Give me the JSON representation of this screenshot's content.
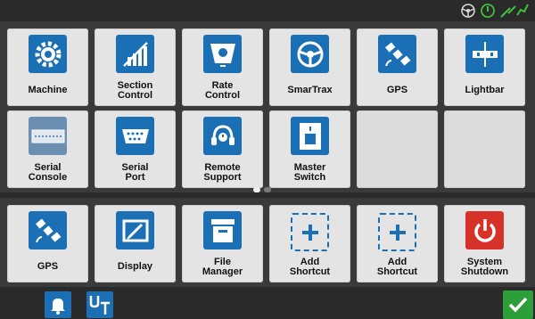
{
  "status_icons": [
    "steering-wheel-icon",
    "power-icon",
    "satellite-signal-icon"
  ],
  "top_tiles": [
    {
      "label": "Machine",
      "icon": "gear-icon"
    },
    {
      "label": "Section\nControl",
      "icon": "section-control-icon"
    },
    {
      "label": "Rate\nControl",
      "icon": "rate-control-icon"
    },
    {
      "label": "SmarTrax",
      "icon": "steering-wheel-icon"
    },
    {
      "label": "GPS",
      "icon": "satellite-icon"
    },
    {
      "label": "Lightbar",
      "icon": "lightbar-icon"
    },
    {
      "label": "Serial\nConsole",
      "icon": "serial-console-icon"
    },
    {
      "label": "Serial\nPort",
      "icon": "serial-port-icon"
    },
    {
      "label": "Remote\nSupport",
      "icon": "headset-icon"
    },
    {
      "label": "Master\nSwitch",
      "icon": "master-switch-icon"
    }
  ],
  "bottom_tiles": [
    {
      "label": "GPS",
      "icon": "satellite-icon"
    },
    {
      "label": "Display",
      "icon": "display-icon"
    },
    {
      "label": "File\nManager",
      "icon": "file-manager-icon"
    },
    {
      "label": "Add\nShortcut",
      "icon": "add-icon"
    },
    {
      "label": "Add\nShortcut",
      "icon": "add-icon"
    },
    {
      "label": "System\nShutdown",
      "icon": "power-icon"
    }
  ],
  "page_indicator": {
    "current": 1,
    "total": 2
  },
  "bottom_bar": {
    "icons": [
      "bell-icon",
      "ut-icon",
      "checkmark-icon"
    ]
  },
  "colors": {
    "accent_blue": "#1b6fb5",
    "shutdown_red": "#d6322a",
    "ok_green": "#2e9e3a"
  }
}
